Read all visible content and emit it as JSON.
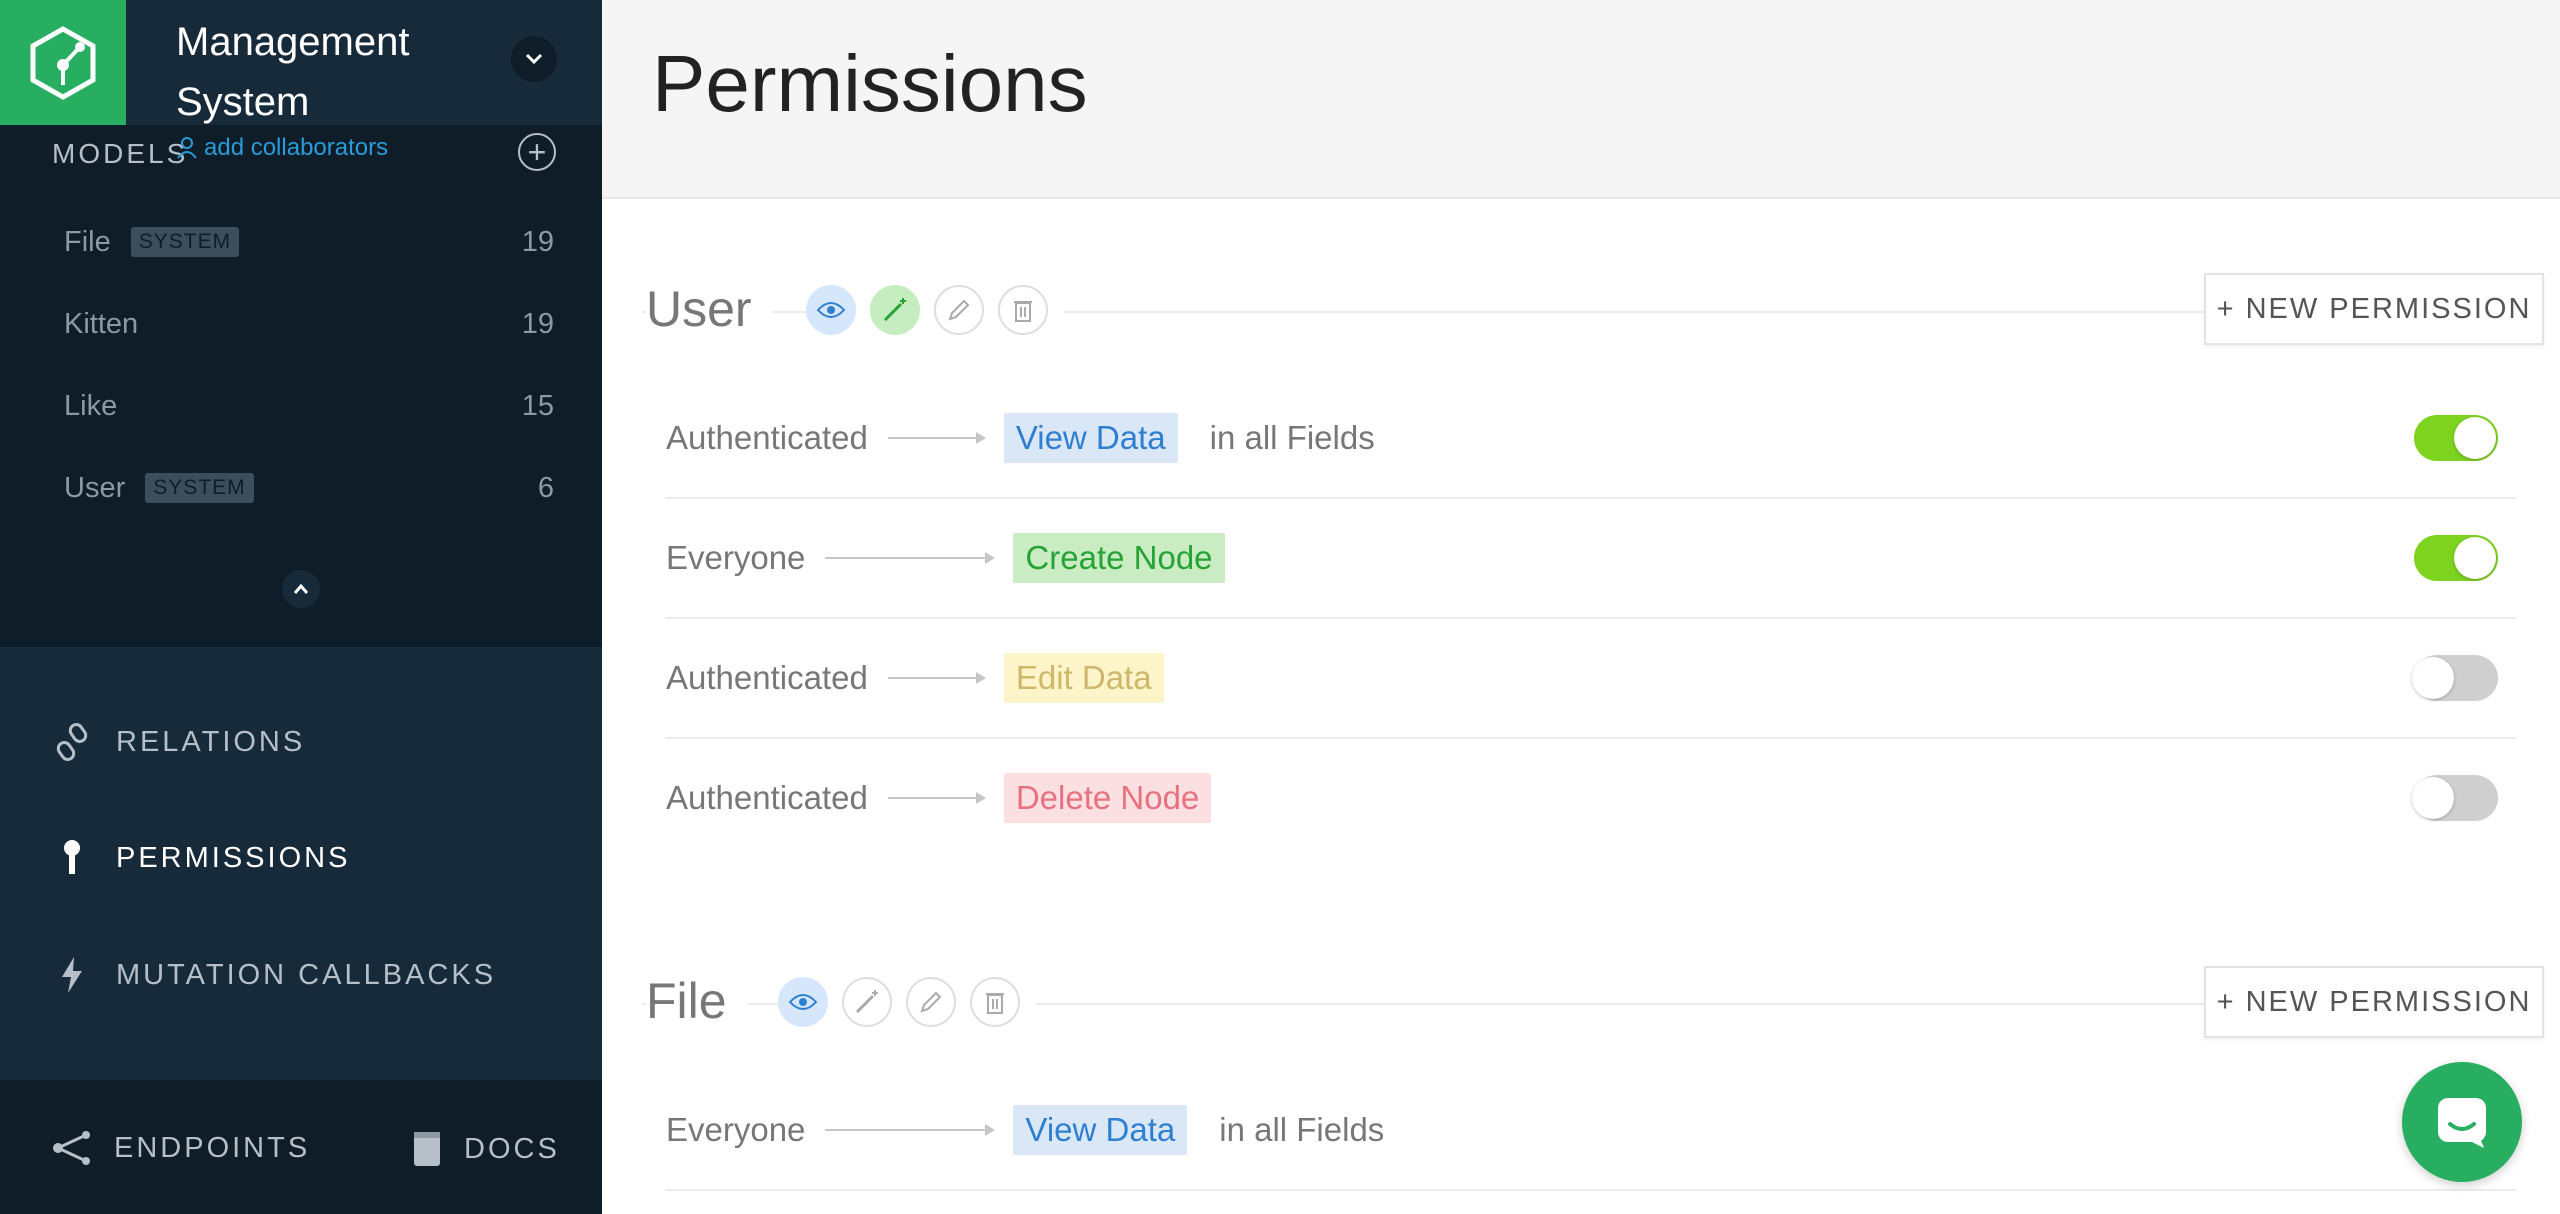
{
  "project": {
    "title": "Management System"
  },
  "models": {
    "header": "MODELS",
    "add_collaborators": "add collaborators",
    "items": [
      {
        "name": "File",
        "badge": "SYSTEM",
        "count": "19"
      },
      {
        "name": "Kitten",
        "badge": "",
        "count": "19"
      },
      {
        "name": "Like",
        "badge": "",
        "count": "15"
      },
      {
        "name": "User",
        "badge": "SYSTEM",
        "count": "6"
      }
    ]
  },
  "nav": {
    "relations": "RELATIONS",
    "permissions": "PERMISSIONS",
    "mutation_callbacks": "MUTATION CALLBACKS",
    "endpoints": "ENDPOINTS",
    "docs": "DOCS"
  },
  "page": {
    "title": "Permissions"
  },
  "sections": [
    {
      "title": "User",
      "new_permission": "+ NEW PERMISSION",
      "rows": [
        {
          "who": "Authenticated",
          "action": "View Data",
          "fields": "in all Fields",
          "enabled": true
        },
        {
          "who": "Everyone",
          "action": "Create Node",
          "fields": "",
          "enabled": true
        },
        {
          "who": "Authenticated",
          "action": "Edit Data",
          "fields": "",
          "enabled": false
        },
        {
          "who": "Authenticated",
          "action": "Delete Node",
          "fields": "",
          "enabled": false
        }
      ]
    },
    {
      "title": "File",
      "new_permission": "+ NEW PERMISSION",
      "rows": [
        {
          "who": "Everyone",
          "action": "View Data",
          "fields": "in all Fields",
          "enabled": true
        }
      ]
    }
  ],
  "colors": {
    "sidebar_bg": "#172a3a",
    "brand_green": "#27ae60",
    "toggle_on": "#7ed321",
    "view": "#2f7fd1",
    "create": "#27a235",
    "edit": "#cdb76b",
    "delete": "#e7727f"
  },
  "icons": {
    "logo": "graph-logo-icon",
    "chat": "chat-icon"
  }
}
